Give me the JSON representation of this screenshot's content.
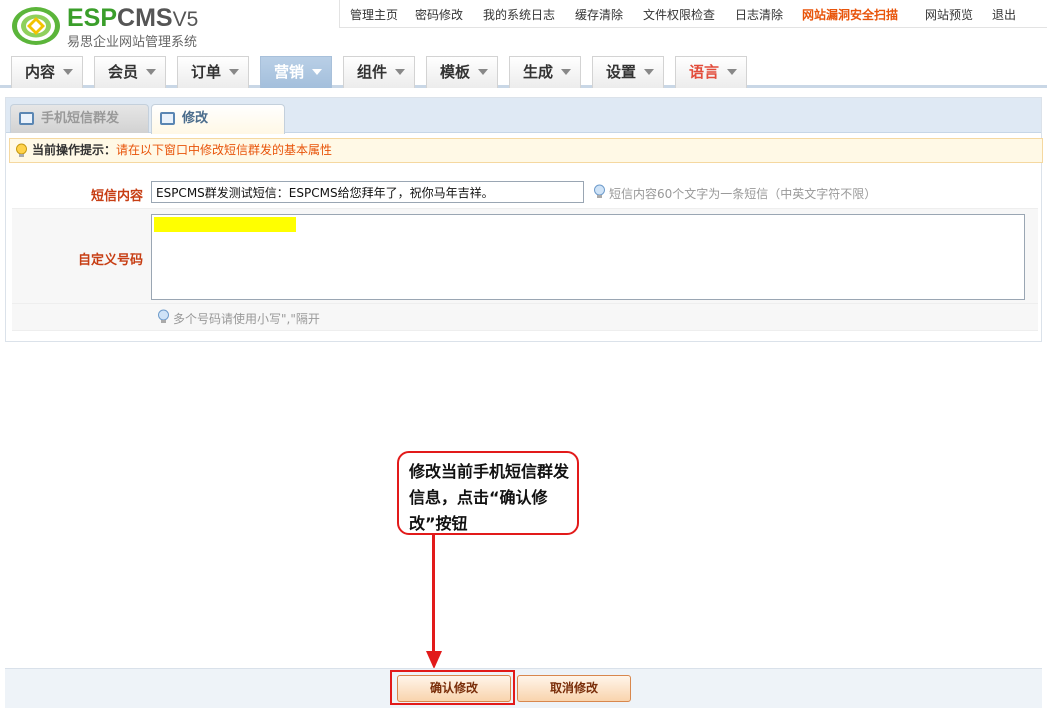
{
  "logo": {
    "brand_part1": "ESP",
    "brand_part2": "CMS",
    "brand_version": "V5",
    "subtitle": "易思企业网站管理系统"
  },
  "top_links": [
    {
      "label": "管理主页"
    },
    {
      "label": "密码修改"
    },
    {
      "label": "我的系统日志"
    },
    {
      "label": "缓存清除"
    },
    {
      "label": "文件权限检查"
    },
    {
      "label": "日志清除"
    },
    {
      "label": "网站漏洞安全扫描",
      "highlight": true
    },
    {
      "label": "网站预览"
    },
    {
      "label": "退出"
    }
  ],
  "main_nav": [
    {
      "label": "内容"
    },
    {
      "label": "会员"
    },
    {
      "label": "订单"
    },
    {
      "label": "营销",
      "active": true
    },
    {
      "label": "组件"
    },
    {
      "label": "模板"
    },
    {
      "label": "生成"
    },
    {
      "label": "设置"
    },
    {
      "label": "语言"
    }
  ],
  "sub_tabs": [
    {
      "label": "手机短信群发",
      "active": false
    },
    {
      "label": "修改",
      "active": true
    }
  ],
  "tip": {
    "label": "当前操作提示：",
    "text": "请在以下窗口中修改短信群发的基本属性"
  },
  "form": {
    "sms_label": "短信内容",
    "sms_value": "ESPCMS群发测试短信：ESPCMS给您拜年了，祝你马年吉祥。",
    "sms_hint": "短信内容60个文字为一条短信（中英文字符不限）",
    "numbers_label": "自定义号码",
    "numbers_value": "",
    "numbers_hint": "多个号码请使用小写\",\"隔开"
  },
  "callout": {
    "text": "修改当前手机短信群发信息，点击“确认修改”按钮"
  },
  "buttons": {
    "confirm": "确认修改",
    "cancel": "取消修改"
  },
  "colors": {
    "accent_orange": "#e8540a",
    "label_red": "#c73e14",
    "callout_red": "#e21a1a",
    "nav_active": "#a3bfdc",
    "brand_green": "#3a9e2a"
  }
}
